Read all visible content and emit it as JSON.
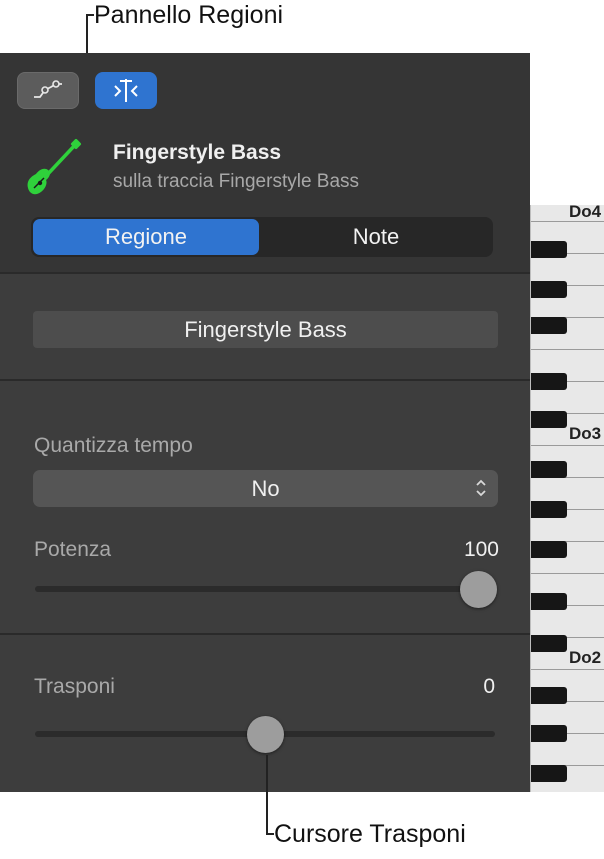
{
  "callouts": {
    "regions_panel": "Pannello Regioni",
    "transpose_slider": "Cursore Trasponi"
  },
  "header": {
    "automation_icon": "automation-curve-icon",
    "region_icon": "region-inspector-icon",
    "track_icon": "bass-guitar-icon",
    "track_name": "Fingerstyle Bass",
    "track_subtitle": "sulla traccia Fingerstyle Bass",
    "track_icon_color": "#2fd13b"
  },
  "tabs": {
    "region": "Regione",
    "notes": "Note",
    "selected": "Regione"
  },
  "region_name": "Fingerstyle Bass",
  "quantize": {
    "label": "Quantizza tempo",
    "value": "No"
  },
  "strength": {
    "label": "Potenza",
    "value": "100",
    "level": 1.0
  },
  "transpose": {
    "label": "Trasponi",
    "value": "0",
    "level": 0.5
  },
  "piano": {
    "labels": [
      "Do4",
      "Do3",
      "Do2"
    ]
  },
  "colors": {
    "accent": "#2f74d0",
    "panel": "#3d3d3d"
  }
}
